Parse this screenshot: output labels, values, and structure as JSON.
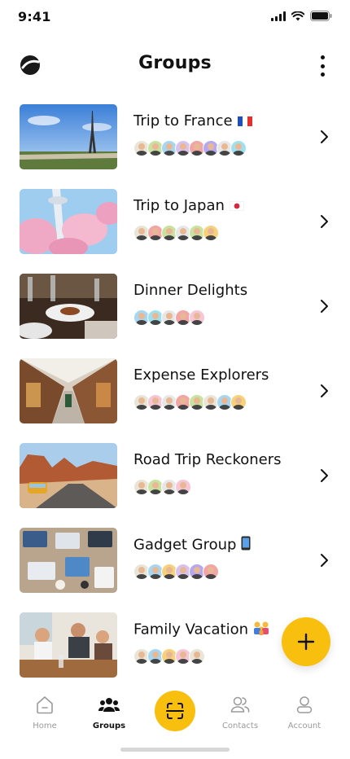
{
  "status_bar": {
    "time": "9:41"
  },
  "header": {
    "title": "Groups"
  },
  "groups": [
    {
      "name": "Trip to France",
      "emoji": "🇫🇷",
      "flag": "france-flag-icon",
      "avatars": 8
    },
    {
      "name": "Trip to Japan",
      "emoji": "🇯🇵",
      "flag": "japan-flag-icon",
      "avatars": 6
    },
    {
      "name": "Dinner Delights",
      "emoji": "",
      "flag": "",
      "avatars": 5
    },
    {
      "name": "Expense Explorers",
      "emoji": "",
      "flag": "",
      "avatars": 8
    },
    {
      "name": "Road Trip Reckoners",
      "emoji": "",
      "flag": "",
      "avatars": 4
    },
    {
      "name": "Gadget Group",
      "emoji": "📱",
      "flag": "mobile-phone-icon",
      "avatars": 6
    },
    {
      "name": "Family Vacation",
      "emoji": "👨‍👩‍👧",
      "flag": "family-icon",
      "avatars": 5
    }
  ],
  "tabs": [
    {
      "label": "Home",
      "icon": "home-icon"
    },
    {
      "label": "Groups",
      "icon": "groups-icon",
      "active": true
    },
    {
      "label": "",
      "icon": "scan-icon"
    },
    {
      "label": "Contacts",
      "icon": "contacts-icon"
    },
    {
      "label": "Account",
      "icon": "account-icon"
    }
  ],
  "colors": {
    "accent": "#f9bf0f",
    "text": "#111111",
    "muted": "#9a9a9a"
  }
}
